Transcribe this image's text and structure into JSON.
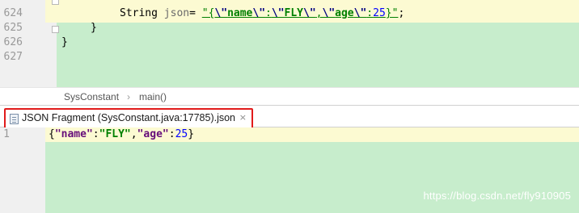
{
  "editor_top": {
    "lines": [
      {
        "number": "624"
      },
      {
        "number": "625"
      },
      {
        "number": "626"
      },
      {
        "number": "627"
      }
    ],
    "code": {
      "line1": {
        "type": "String",
        "var": "json",
        "assign": "= ",
        "q_open": "\"{",
        "esc1": "\\\"",
        "s1": "name",
        "esc2": "\\\"",
        "colon1": ":",
        "esc3": "\\\"",
        "s2": "FLY",
        "esc4": "\\\"",
        "comma": ",",
        "esc5": "\\\"",
        "s3": "age",
        "esc6": "\\\"",
        "colon2": ":",
        "num": "25",
        "q_close": "}\"",
        "end": ";"
      },
      "line2": "}",
      "line3": "}"
    }
  },
  "breadcrumb": {
    "items": [
      "SysConstant",
      "main()"
    ],
    "separator": "›"
  },
  "tab": {
    "label": "JSON Fragment (SysConstant.java:17785).json",
    "close": "×"
  },
  "editor_bottom": {
    "line_number": "1",
    "code": {
      "open": "{",
      "k1": "\"name\"",
      "c1": ":",
      "v1": "\"FLY\"",
      "comma": ",",
      "k2": "\"age\"",
      "c2": ":",
      "v2": "25",
      "close": "}"
    }
  },
  "watermark": "https://blog.csdn.net/fly910905",
  "colors": {
    "editor_bg": "#c7edcc",
    "highlight": "#fcfad2",
    "tab_border": "#e11b1b",
    "string": "#008000",
    "number": "#0000ff",
    "key": "#660e7a"
  }
}
